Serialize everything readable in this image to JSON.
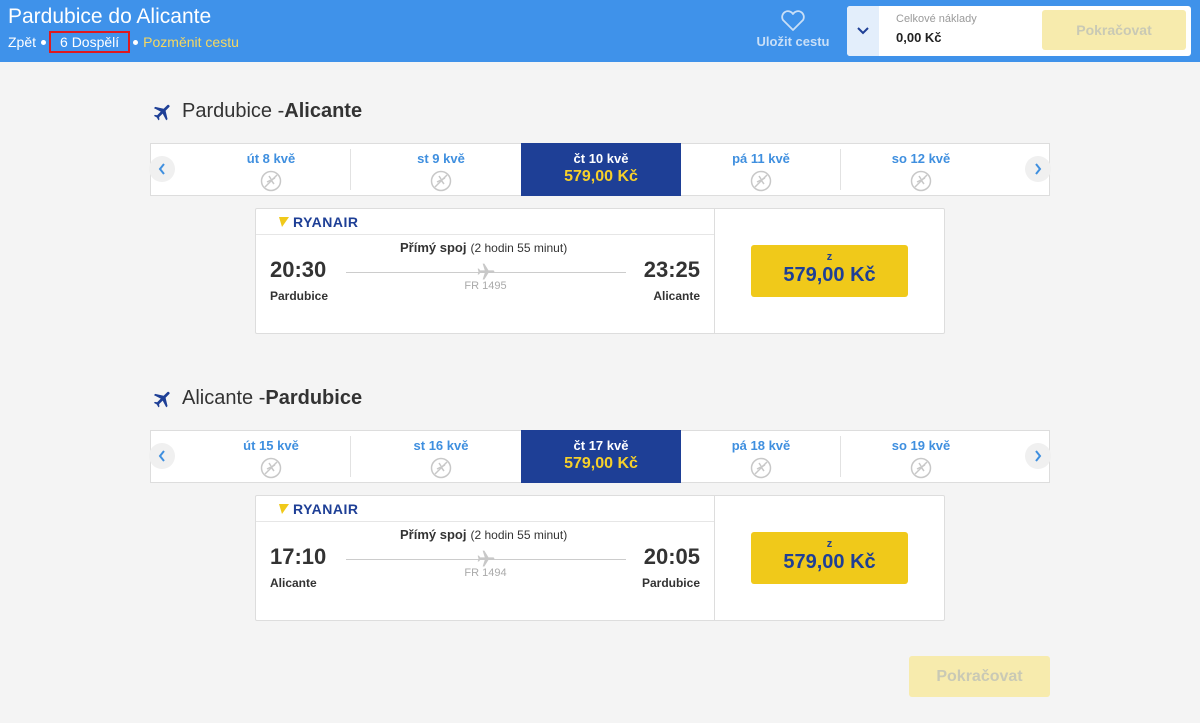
{
  "header": {
    "title": "Pardubice do Alicante",
    "back_label": "Zpět",
    "passengers_label": "6 Dospělí",
    "change_label": "Pozměnit cestu",
    "save_label": "Uložit cestu",
    "total_cost_label": "Celkové náklady",
    "total_cost_value": "0,00 Kč",
    "continue_label": "Pokračovat"
  },
  "outbound": {
    "from": "Pardubice - ",
    "to": "Alicante",
    "dates": [
      {
        "label": "út 8 kvě",
        "price": null
      },
      {
        "label": "st 9 kvě",
        "price": null
      },
      {
        "label": "čt 10 kvě",
        "price": "579,00 Kč"
      },
      {
        "label": "pá 11 kvě",
        "price": null
      },
      {
        "label": "so 12 kvě",
        "price": null
      }
    ],
    "flight": {
      "carrier": "RYANAIR",
      "type": "Přímý spoj",
      "duration": "(2 hodin 55 minut)",
      "dep_time": "20:30",
      "arr_time": "23:25",
      "dep_city": "Pardubice",
      "arr_city": "Alicante",
      "flight_no": "FR 1495",
      "from_label": "z",
      "price": "579,00 Kč"
    }
  },
  "inbound": {
    "from": "Alicante - ",
    "to": "Pardubice",
    "dates": [
      {
        "label": "út 15 kvě",
        "price": null
      },
      {
        "label": "st 16 kvě",
        "price": null
      },
      {
        "label": "čt 17 kvě",
        "price": "579,00 Kč"
      },
      {
        "label": "pá 18 kvě",
        "price": null
      },
      {
        "label": "so 19 kvě",
        "price": null
      }
    ],
    "flight": {
      "carrier": "RYANAIR",
      "type": "Přímý spoj",
      "duration": "(2 hodin 55 minut)",
      "dep_time": "17:10",
      "arr_time": "20:05",
      "dep_city": "Alicante",
      "arr_city": "Pardubice",
      "flight_no": "FR 1494",
      "from_label": "z",
      "price": "579,00 Kč"
    }
  },
  "footer": {
    "continue_label": "Pokračovat"
  },
  "colors": {
    "header_bg": "#3f92ea",
    "selected_date_bg": "#1e3f96",
    "price_button": "#f0c91a",
    "disabled_continue": "#f7ebad"
  }
}
